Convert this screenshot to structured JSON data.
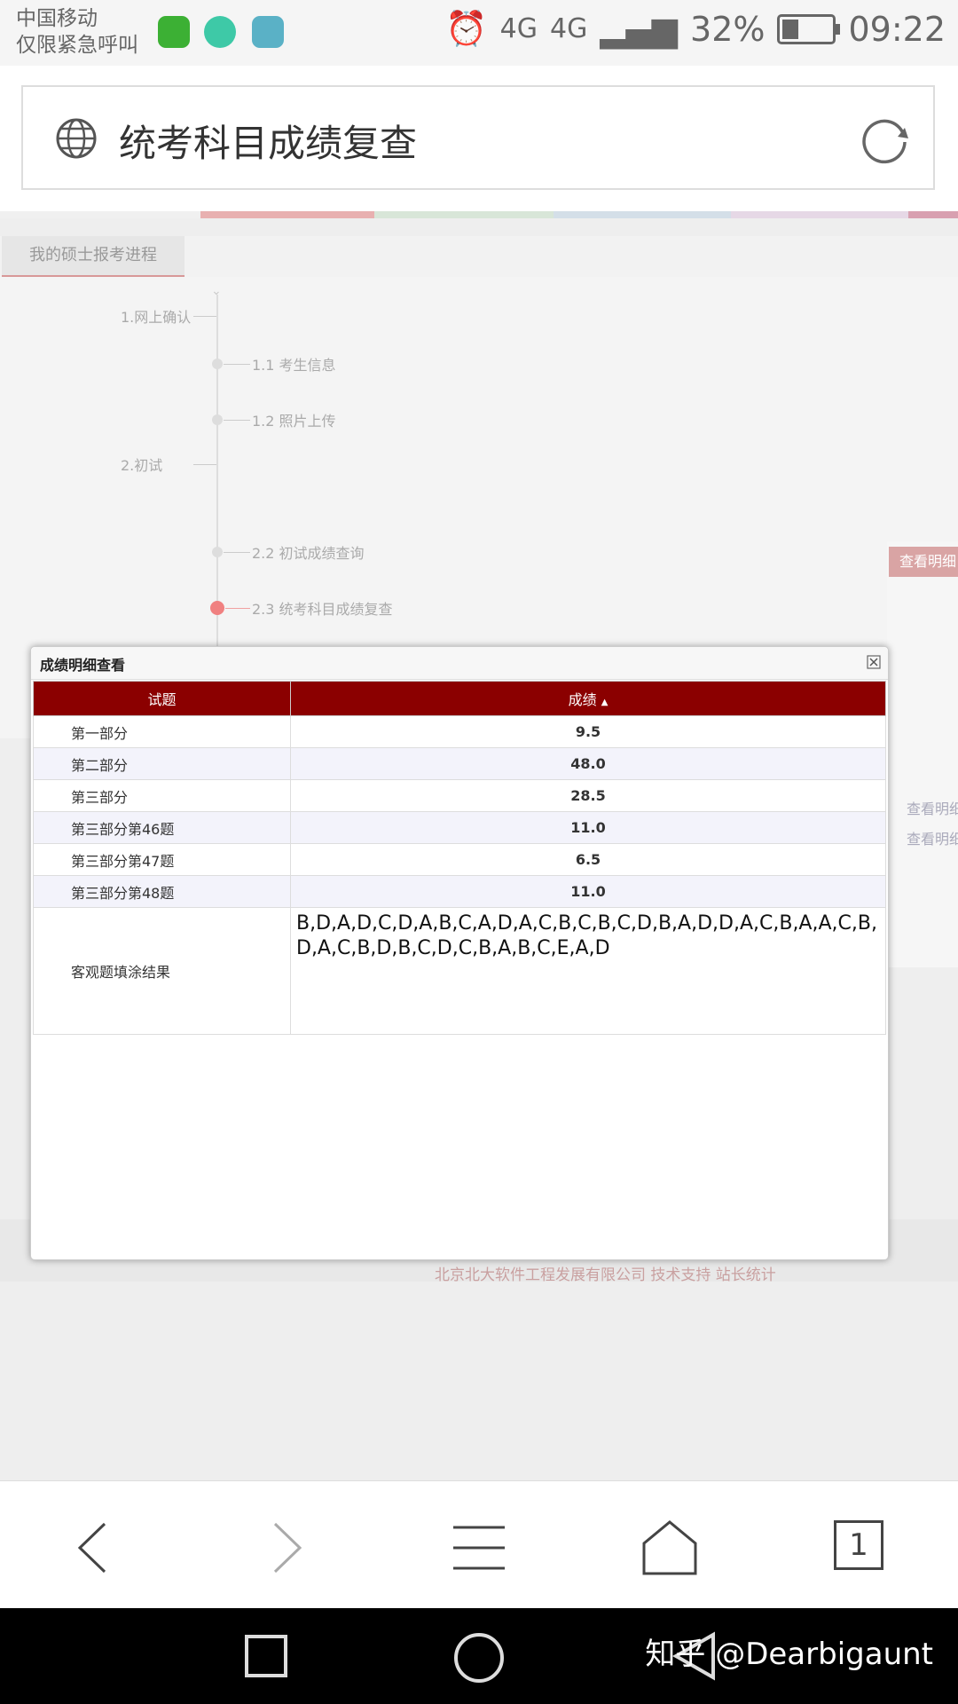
{
  "status": {
    "carrier_line1": "中国移动",
    "carrier_line2": "仅限紧急呼叫",
    "network1": "4G",
    "network2": "4G",
    "battery_percent": "32%",
    "battery_level": 0.32,
    "time": "09:22"
  },
  "address": {
    "page_title": "统考科目成绩复查"
  },
  "tab": {
    "label": "我的硕士报考进程"
  },
  "steps": {
    "s1": "1.网上确认",
    "s11": "1.1 考生信息",
    "s12": "1.2 照片上传",
    "s2": "2.初试",
    "s22": "2.2 初试成绩查询",
    "s23": "2.3 统考科目成绩复查"
  },
  "right_panel": {
    "btn": "查看明细",
    "link1": "查看明细",
    "link2": "查看明细"
  },
  "dialog": {
    "title": "成绩明细查看",
    "col1": "试题",
    "col2": "成绩",
    "sort_glyph": "▲",
    "rows": [
      {
        "name": "第一部分",
        "score": "9.5"
      },
      {
        "name": "第二部分",
        "score": "48.0"
      },
      {
        "name": "第三部分",
        "score": "28.5"
      },
      {
        "name": "第三部分第46题",
        "score": "11.0"
      },
      {
        "name": "第三部分第47题",
        "score": "6.5"
      },
      {
        "name": "第三部分第48题",
        "score": "11.0"
      }
    ],
    "objective_label": "客观题填涂结果",
    "objective_value": "B,D,A,D,C,D,A,B,C,A,D,A,C,B,C,B,C,D,B,A,D,D,A,C,B,A,A,C,B,D,A,C,B,D,B,C,D,C,B,A,B,C,E,A,D"
  },
  "footer": {
    "text": "北京北大软件工程发展有限公司 技术支持 站长统计"
  },
  "browser_nav": {
    "tab_count": "1"
  },
  "watermark": "知乎 @Dearbigaunt",
  "colors": {
    "header_red": "#8b0000",
    "accent_pink": "#f08080"
  }
}
